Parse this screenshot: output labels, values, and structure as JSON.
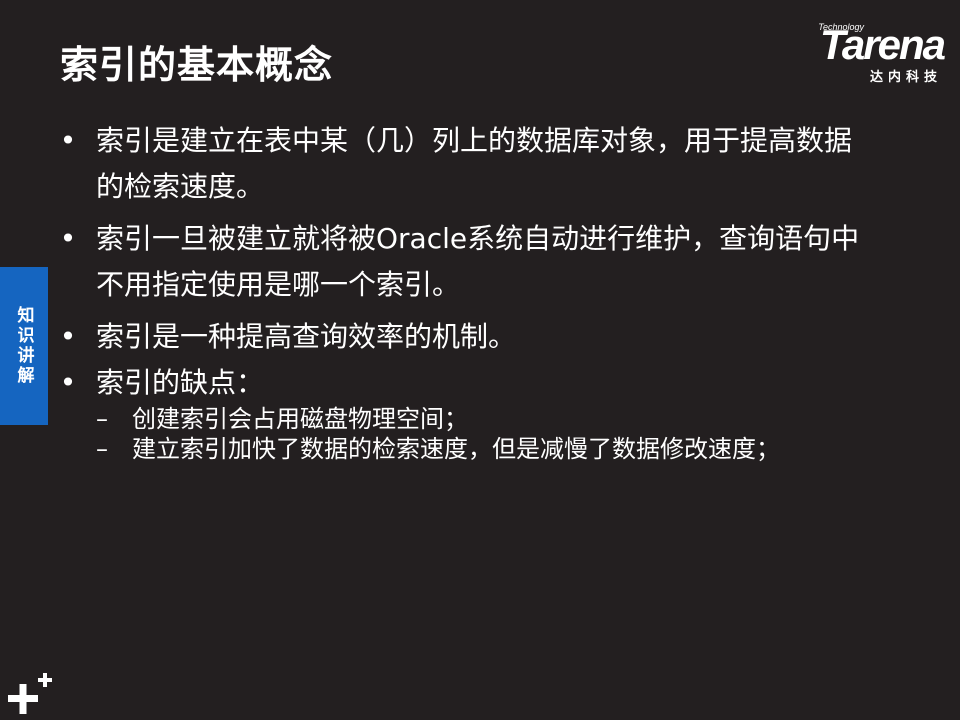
{
  "slide": {
    "title": "索引的基本概念",
    "side_tab": "知识讲解",
    "logo": {
      "tagline": "Technology",
      "wordmark": "Tarena",
      "cn": "达内科技"
    },
    "bullets": [
      {
        "marker": "•",
        "text": "索引是建立在表中某（几）列上的数据库对象，用于提高数据的检索速度。"
      },
      {
        "marker": "•",
        "text": "索引一旦被建立就将被Oracle系统自动进行维护，查询语句中不用指定使用是哪一个索引。"
      },
      {
        "marker": "•",
        "text": "索引是一种提高查询效率的机制。"
      },
      {
        "marker": "•",
        "text": "索引的缺点："
      }
    ],
    "sub_bullets": [
      {
        "marker": "–",
        "text": "创建索引会占用磁盘物理空间；"
      },
      {
        "marker": "–",
        "text": "建立索引加快了数据的检索速度，但是减慢了数据修改速度；"
      }
    ]
  }
}
